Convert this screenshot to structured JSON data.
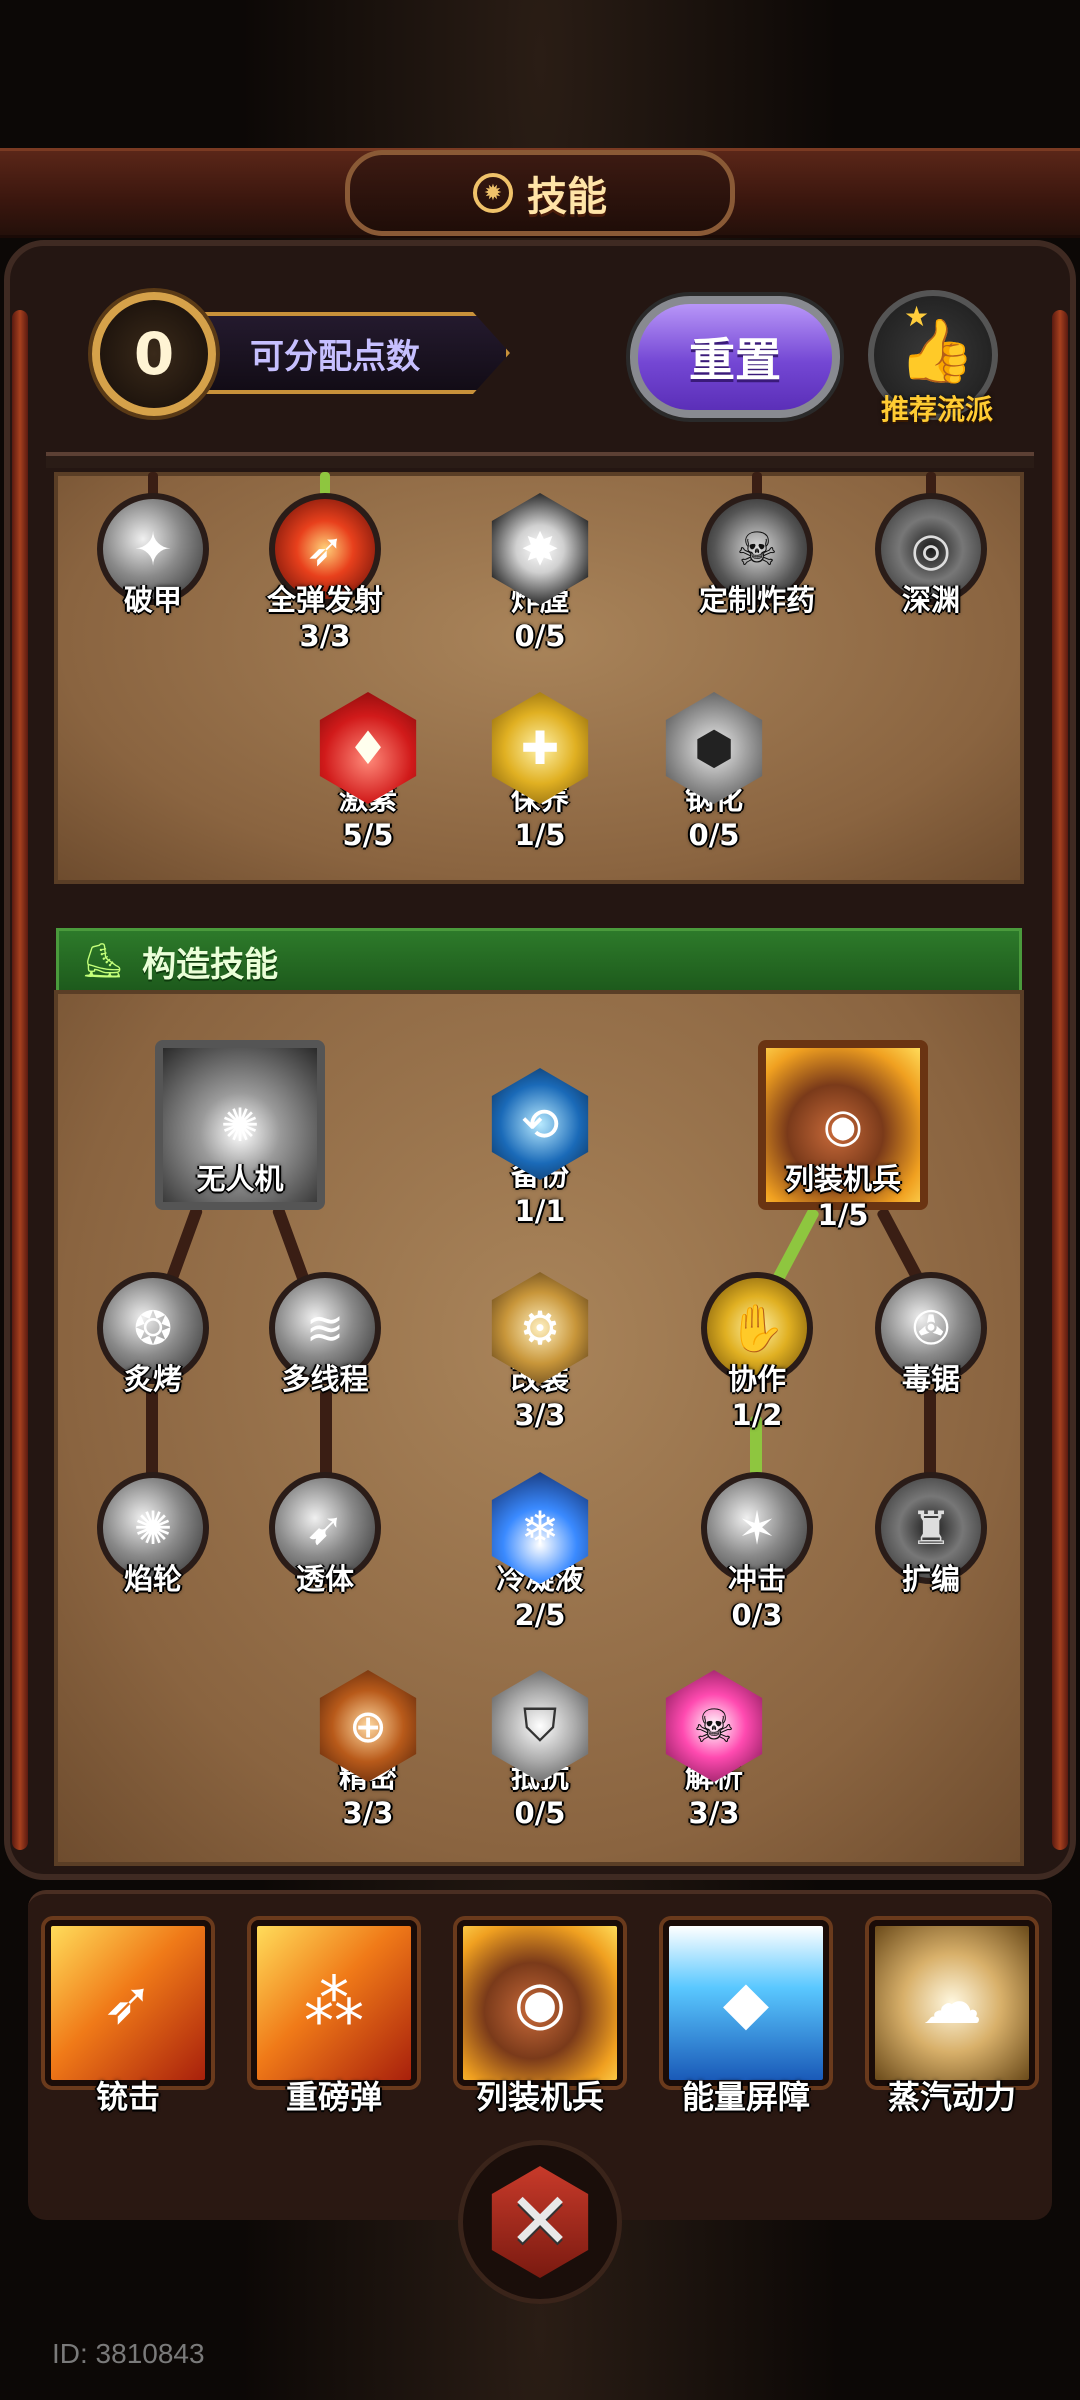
{
  "title": {
    "text": "技能",
    "icon": "gear-icon"
  },
  "points": {
    "value": "0",
    "label": "可分配点数"
  },
  "reset_label": "重置",
  "recommend_label": "推荐流派",
  "section_header": {
    "text": "构造技能",
    "icon": "boot-icon"
  },
  "upper_nodes": [
    {
      "name": "破甲",
      "level": "",
      "icon": "armor-break-icon"
    },
    {
      "name": "全弹发射",
      "level": "3/3",
      "icon": "barrage-icon"
    },
    {
      "name": "炸膛",
      "level": "0/5",
      "icon": "burst-icon"
    },
    {
      "name": "定制炸药",
      "level": "",
      "icon": "skull-bomb-icon"
    },
    {
      "name": "深渊",
      "level": "",
      "icon": "vortex-icon"
    },
    {
      "name": "激素",
      "level": "5/5",
      "icon": "crystal-icon"
    },
    {
      "name": "保养",
      "level": "1/5",
      "icon": "heart-shield-icon"
    },
    {
      "name": "钢化",
      "level": "0/5",
      "icon": "steel-shield-icon"
    }
  ],
  "build_nodes": [
    {
      "name": "无人机",
      "level": "",
      "icon": "drone-icon"
    },
    {
      "name": "备份",
      "level": "1/1",
      "icon": "backup-icon"
    },
    {
      "name": "列装机兵",
      "level": "1/5",
      "icon": "robot-icon"
    },
    {
      "name": "炙烤",
      "level": "",
      "icon": "roast-icon"
    },
    {
      "name": "多线程",
      "level": "",
      "icon": "multithread-icon"
    },
    {
      "name": "改装",
      "level": "3/3",
      "icon": "modify-icon"
    },
    {
      "name": "协作",
      "level": "1/2",
      "icon": "cooperate-icon"
    },
    {
      "name": "毒锯",
      "level": "",
      "icon": "saw-icon"
    },
    {
      "name": "焰轮",
      "level": "",
      "icon": "flame-wheel-icon"
    },
    {
      "name": "透体",
      "level": "",
      "icon": "pierce-icon"
    },
    {
      "name": "冷凝液",
      "level": "2/5",
      "icon": "condensate-icon"
    },
    {
      "name": "冲击",
      "level": "0/3",
      "icon": "impact-icon"
    },
    {
      "name": "扩编",
      "level": "",
      "icon": "expand-icon"
    },
    {
      "name": "精密",
      "level": "3/3",
      "icon": "precision-icon"
    },
    {
      "name": "抵抗",
      "level": "0/5",
      "icon": "resist-icon"
    },
    {
      "name": "解析",
      "level": "3/3",
      "icon": "analyze-icon"
    }
  ],
  "loadout": [
    {
      "name": "铳击",
      "icon": "gun-strike-icon"
    },
    {
      "name": "重磅弹",
      "icon": "heavy-shell-icon"
    },
    {
      "name": "列装机兵",
      "icon": "robot-icon"
    },
    {
      "name": "能量屏障",
      "icon": "energy-barrier-icon"
    },
    {
      "name": "蒸汽动力",
      "icon": "steam-power-icon"
    }
  ],
  "id_text": "ID: 3810843",
  "colors": {
    "accent_gold": "#d6a24a",
    "reset_purple": "#7447d4",
    "section_green": "#2d7a2a",
    "active_line": "#8ec63f"
  }
}
